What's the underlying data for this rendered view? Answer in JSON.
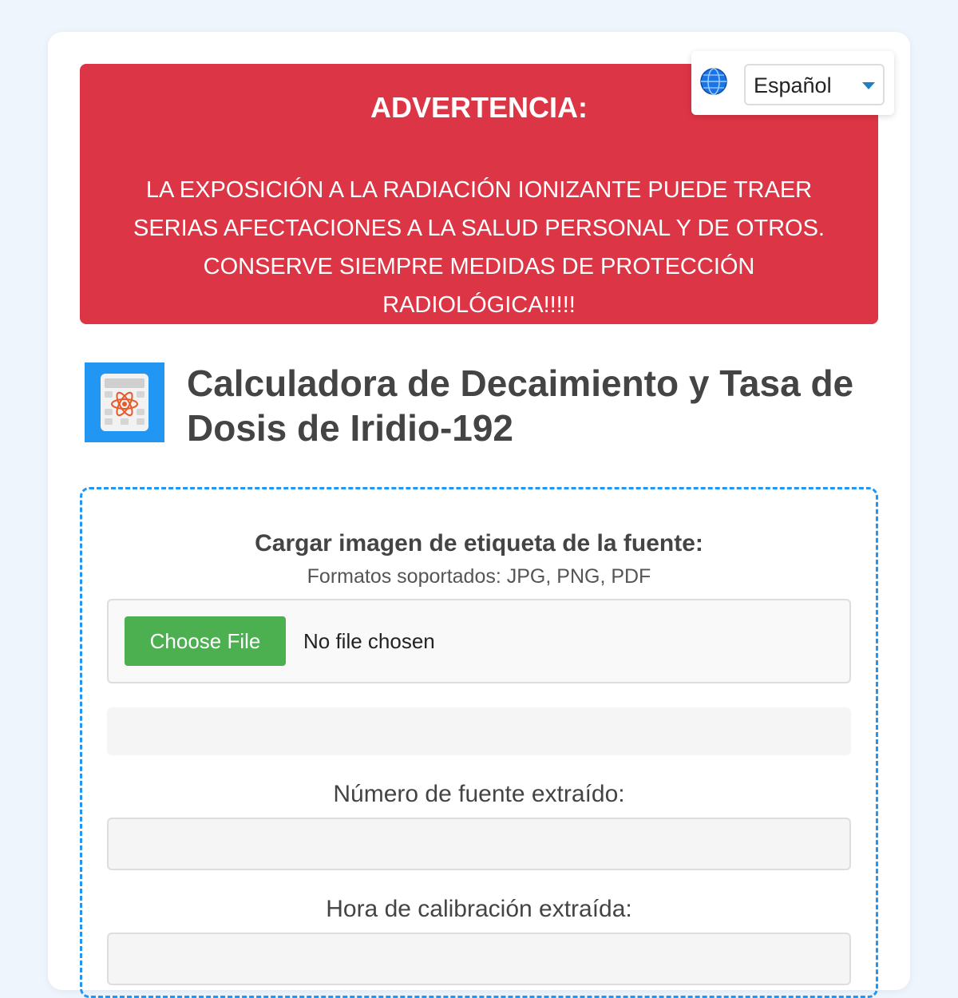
{
  "language": {
    "selected": "Español"
  },
  "warning": {
    "title": "ADVERTENCIA:",
    "body": "LA EXPOSICIÓN A LA RADIACIÓN IONIZANTE PUEDE TRAER\nSERIAS AFECTACIONES A LA SALUD PERSONAL Y DE OTROS.\nCONSERVE SIEMPRE MEDIDAS DE PROTECCIÓN\nRADIOLÓGICA!!!!!"
  },
  "header": {
    "title": "Calculadora de Decaimiento y Tasa de Dosis de Iridio-192",
    "icon": "calculator-atom-icon"
  },
  "upload": {
    "label": "Cargar imagen de etiqueta de la fuente:",
    "formats": "Formatos soportados: JPG, PNG, PDF",
    "choose_button": "Choose File",
    "no_file": "No file chosen"
  },
  "fields": {
    "source_number_label": "Número de fuente extraído:",
    "source_number_value": "",
    "calibration_time_label": "Hora de calibración extraída:",
    "calibration_time_value": ""
  },
  "colors": {
    "warning_bg": "#dc3545",
    "accent": "#2196f3",
    "button": "#4caf50"
  }
}
